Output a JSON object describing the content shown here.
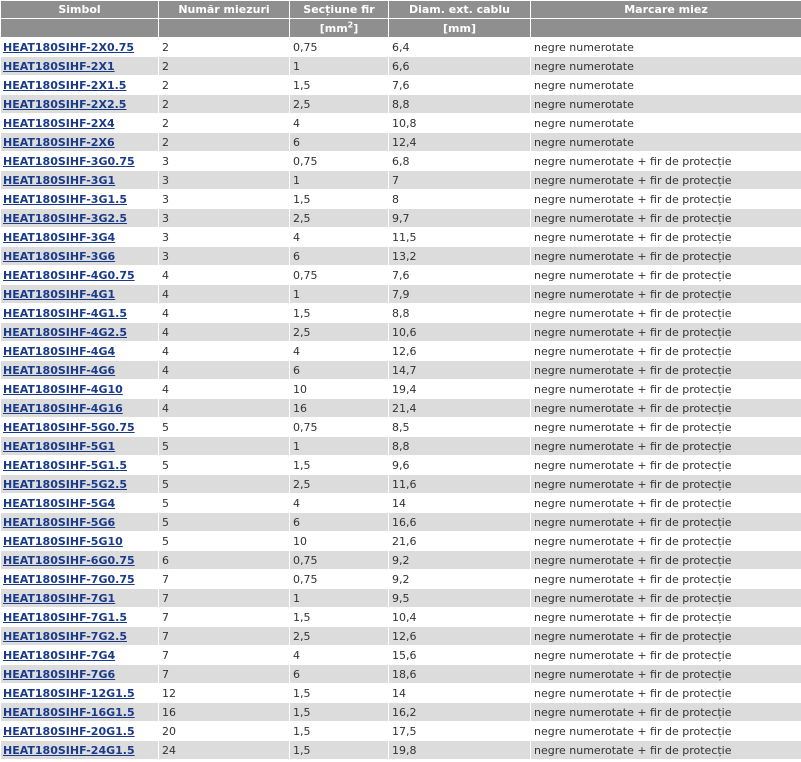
{
  "headers": {
    "symbol": "Simbol",
    "cores": "Număr miezuri",
    "section": "Secțiune fir",
    "diameter": "Diam. ext. cablu",
    "marking": "Marcare miez"
  },
  "units": {
    "section_prefix": "[mm",
    "section_power": "2",
    "section_suffix": "]",
    "diameter": "[mm]"
  },
  "rows": [
    {
      "symbol": "HEAT180SIHF-2X0.75",
      "cores": "2",
      "section": "0,75",
      "diameter": "6,4",
      "marking": "negre numerotate"
    },
    {
      "symbol": "HEAT180SIHF-2X1",
      "cores": "2",
      "section": "1",
      "diameter": "6,6",
      "marking": "negre numerotate"
    },
    {
      "symbol": "HEAT180SIHF-2X1.5",
      "cores": "2",
      "section": "1,5",
      "diameter": "7,6",
      "marking": "negre numerotate"
    },
    {
      "symbol": "HEAT180SIHF-2X2.5",
      "cores": "2",
      "section": "2,5",
      "diameter": "8,8",
      "marking": "negre numerotate"
    },
    {
      "symbol": "HEAT180SIHF-2X4",
      "cores": "2",
      "section": "4",
      "diameter": "10,8",
      "marking": "negre numerotate"
    },
    {
      "symbol": "HEAT180SIHF-2X6",
      "cores": "2",
      "section": "6",
      "diameter": "12,4",
      "marking": "negre numerotate"
    },
    {
      "symbol": "HEAT180SIHF-3G0.75",
      "cores": "3",
      "section": "0,75",
      "diameter": "6,8",
      "marking": "negre numerotate + fir de protecție"
    },
    {
      "symbol": "HEAT180SIHF-3G1",
      "cores": "3",
      "section": "1",
      "diameter": "7",
      "marking": "negre numerotate + fir de protecție"
    },
    {
      "symbol": "HEAT180SIHF-3G1.5",
      "cores": "3",
      "section": "1,5",
      "diameter": "8",
      "marking": "negre numerotate + fir de protecție"
    },
    {
      "symbol": "HEAT180SIHF-3G2.5",
      "cores": "3",
      "section": "2,5",
      "diameter": "9,7",
      "marking": "negre numerotate + fir de protecție"
    },
    {
      "symbol": "HEAT180SIHF-3G4",
      "cores": "3",
      "section": "4",
      "diameter": "11,5",
      "marking": "negre numerotate + fir de protecție"
    },
    {
      "symbol": "HEAT180SIHF-3G6",
      "cores": "3",
      "section": "6",
      "diameter": "13,2",
      "marking": "negre numerotate + fir de protecție"
    },
    {
      "symbol": "HEAT180SIHF-4G0.75",
      "cores": "4",
      "section": "0,75",
      "diameter": "7,6",
      "marking": "negre numerotate + fir de protecție"
    },
    {
      "symbol": "HEAT180SIHF-4G1",
      "cores": "4",
      "section": "1",
      "diameter": "7,9",
      "marking": "negre numerotate + fir de protecție"
    },
    {
      "symbol": "HEAT180SIHF-4G1.5",
      "cores": "4",
      "section": "1,5",
      "diameter": "8,8",
      "marking": "negre numerotate + fir de protecție"
    },
    {
      "symbol": "HEAT180SIHF-4G2.5",
      "cores": "4",
      "section": "2,5",
      "diameter": "10,6",
      "marking": "negre numerotate + fir de protecție"
    },
    {
      "symbol": "HEAT180SIHF-4G4",
      "cores": "4",
      "section": "4",
      "diameter": "12,6",
      "marking": "negre numerotate + fir de protecție"
    },
    {
      "symbol": "HEAT180SIHF-4G6",
      "cores": "4",
      "section": "6",
      "diameter": "14,7",
      "marking": "negre numerotate + fir de protecție"
    },
    {
      "symbol": "HEAT180SIHF-4G10",
      "cores": "4",
      "section": "10",
      "diameter": "19,4",
      "marking": "negre numerotate + fir de protecție"
    },
    {
      "symbol": "HEAT180SIHF-4G16",
      "cores": "4",
      "section": "16",
      "diameter": "21,4",
      "marking": "negre numerotate + fir de protecție"
    },
    {
      "symbol": "HEAT180SIHF-5G0.75",
      "cores": "5",
      "section": "0,75",
      "diameter": "8,5",
      "marking": "negre numerotate + fir de protecție"
    },
    {
      "symbol": "HEAT180SIHF-5G1",
      "cores": "5",
      "section": "1",
      "diameter": "8,8",
      "marking": "negre numerotate + fir de protecție"
    },
    {
      "symbol": "HEAT180SIHF-5G1.5",
      "cores": "5",
      "section": "1,5",
      "diameter": "9,6",
      "marking": "negre numerotate + fir de protecție"
    },
    {
      "symbol": "HEAT180SIHF-5G2.5",
      "cores": "5",
      "section": "2,5",
      "diameter": "11,6",
      "marking": "negre numerotate + fir de protecție"
    },
    {
      "symbol": "HEAT180SIHF-5G4",
      "cores": "5",
      "section": "4",
      "diameter": "14",
      "marking": "negre numerotate + fir de protecție"
    },
    {
      "symbol": "HEAT180SIHF-5G6",
      "cores": "5",
      "section": "6",
      "diameter": "16,6",
      "marking": "negre numerotate + fir de protecție"
    },
    {
      "symbol": "HEAT180SIHF-5G10",
      "cores": "5",
      "section": "10",
      "diameter": "21,6",
      "marking": "negre numerotate + fir de protecție"
    },
    {
      "symbol": "HEAT180SIHF-6G0.75",
      "cores": "6",
      "section": "0,75",
      "diameter": "9,2",
      "marking": "negre numerotate + fir de protecție"
    },
    {
      "symbol": "HEAT180SIHF-7G0.75",
      "cores": "7",
      "section": "0,75",
      "diameter": "9,2",
      "marking": "negre numerotate + fir de protecție"
    },
    {
      "symbol": "HEAT180SIHF-7G1",
      "cores": "7",
      "section": "1",
      "diameter": "9,5",
      "marking": "negre numerotate + fir de protecție"
    },
    {
      "symbol": "HEAT180SIHF-7G1.5",
      "cores": "7",
      "section": "1,5",
      "diameter": "10,4",
      "marking": "negre numerotate + fir de protecție"
    },
    {
      "symbol": "HEAT180SIHF-7G2.5",
      "cores": "7",
      "section": "2,5",
      "diameter": "12,6",
      "marking": "negre numerotate + fir de protecție"
    },
    {
      "symbol": "HEAT180SIHF-7G4",
      "cores": "7",
      "section": "4",
      "diameter": "15,6",
      "marking": "negre numerotate + fir de protecție"
    },
    {
      "symbol": "HEAT180SIHF-7G6",
      "cores": "7",
      "section": "6",
      "diameter": "18,6",
      "marking": "negre numerotate + fir de protecție"
    },
    {
      "symbol": "HEAT180SIHF-12G1.5",
      "cores": "12",
      "section": "1,5",
      "diameter": "14",
      "marking": "negre numerotate + fir de protecție"
    },
    {
      "symbol": "HEAT180SIHF-16G1.5",
      "cores": "16",
      "section": "1,5",
      "diameter": "16,2",
      "marking": "negre numerotate + fir de protecție"
    },
    {
      "symbol": "HEAT180SIHF-20G1.5",
      "cores": "20",
      "section": "1,5",
      "diameter": "17,5",
      "marking": "negre numerotate + fir de protecție"
    },
    {
      "symbol": "HEAT180SIHF-24G1.5",
      "cores": "24",
      "section": "1,5",
      "diameter": "19,8",
      "marking": "negre numerotate + fir de protecție"
    }
  ],
  "colors": {
    "header_bg": "#8f8f8f",
    "header_text": "#ffffff",
    "row_alt_bg": "#dcdcdc",
    "link": "#1a3a8a"
  }
}
